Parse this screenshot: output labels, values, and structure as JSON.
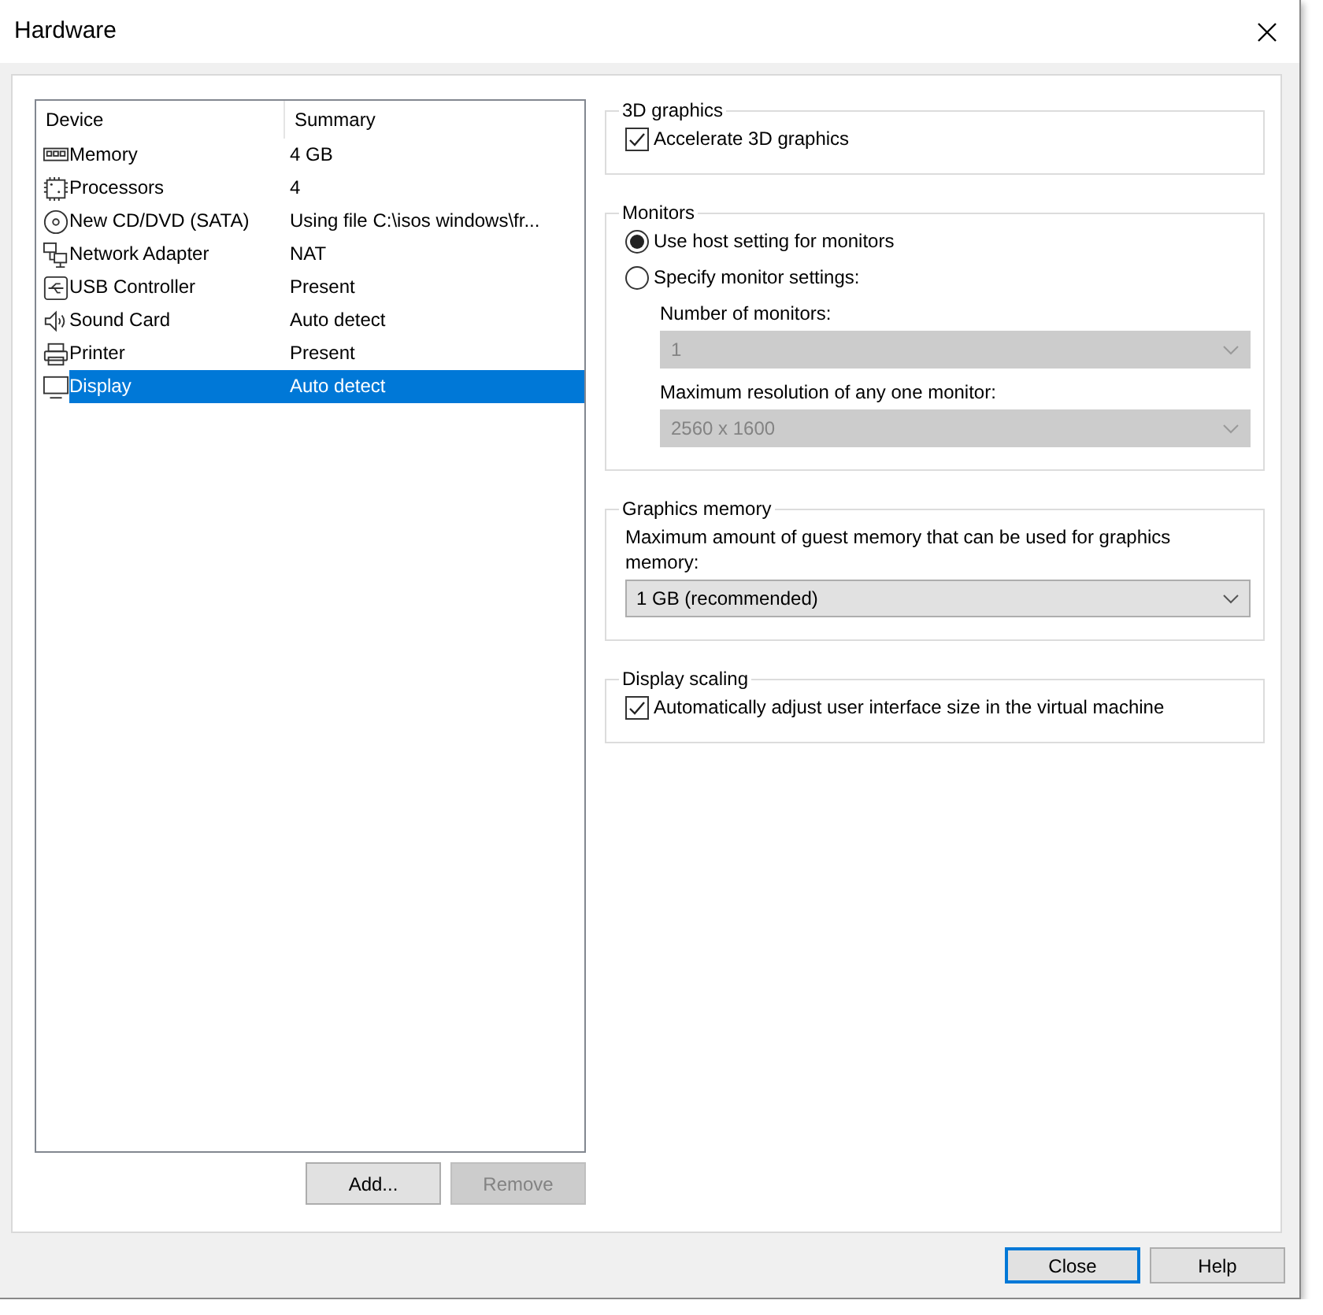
{
  "window": {
    "title": "Hardware"
  },
  "devices": {
    "columns": [
      "Device",
      "Summary"
    ],
    "rows": [
      {
        "name": "Memory",
        "summary": "4 GB",
        "selected": false
      },
      {
        "name": "Processors",
        "summary": "4",
        "selected": false
      },
      {
        "name": "New CD/DVD (SATA)",
        "summary": "Using file C:\\isos windows\\fr...",
        "selected": false
      },
      {
        "name": "Network Adapter",
        "summary": "NAT",
        "selected": false
      },
      {
        "name": "USB Controller",
        "summary": "Present",
        "selected": false
      },
      {
        "name": "Sound Card",
        "summary": "Auto detect",
        "selected": false
      },
      {
        "name": "Printer",
        "summary": "Present",
        "selected": false
      },
      {
        "name": "Display",
        "summary": "Auto detect",
        "selected": true
      }
    ],
    "buttons": [
      {
        "label": "Add...",
        "disabled": false
      },
      {
        "label": "Remove",
        "disabled": true
      }
    ]
  },
  "groups": [
    {
      "title": "3D graphics",
      "controls": [
        {
          "kind": "checkbox",
          "label": "Accelerate 3D graphics",
          "checked": true
        }
      ]
    },
    {
      "title": "Monitors",
      "controls": [
        {
          "kind": "radio",
          "label": "Use host setting for monitors",
          "selected": true
        },
        {
          "kind": "radio",
          "label": "Specify monitor settings:",
          "selected": false,
          "children": [
            {
              "kind": "label",
              "label": "Number of monitors:"
            },
            {
              "kind": "select",
              "value": "1",
              "disabled": true
            },
            {
              "kind": "label",
              "label": "Maximum resolution of any one monitor:"
            },
            {
              "kind": "select",
              "value": "2560 x 1600",
              "disabled": true
            }
          ]
        }
      ]
    },
    {
      "title": "Graphics memory",
      "controls": [
        {
          "kind": "label",
          "label": "Maximum amount of guest memory that can be used for graphics memory:"
        },
        {
          "kind": "select",
          "value": "1 GB (recommended)",
          "disabled": false
        }
      ]
    },
    {
      "title": "Display scaling",
      "controls": [
        {
          "kind": "checkbox",
          "label": "Automatically adjust user interface size in the virtual machine",
          "checked": true
        }
      ]
    }
  ],
  "footer_buttons": [
    {
      "label": "Close",
      "focused": true
    },
    {
      "label": "Help",
      "focused": false
    }
  ]
}
